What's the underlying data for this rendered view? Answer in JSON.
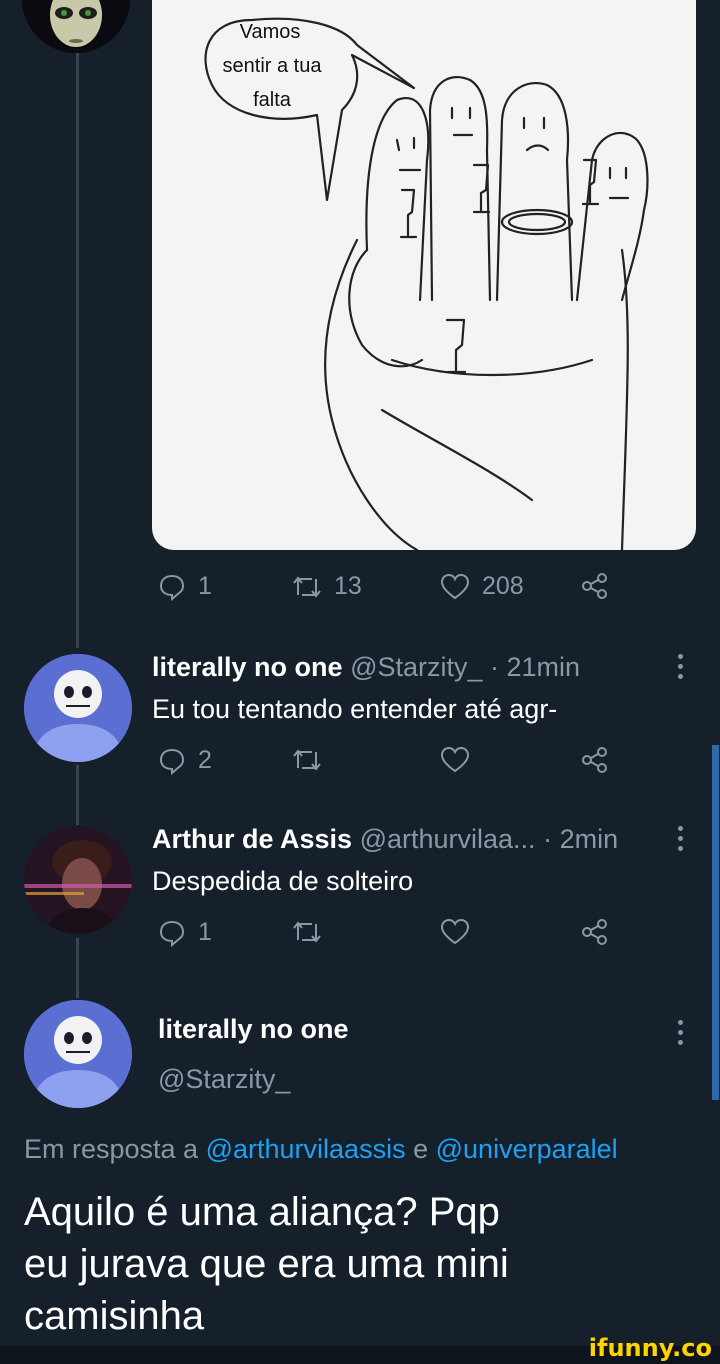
{
  "media": {
    "speech_bubble": [
      "Vamos",
      "sentir a tua",
      "falta"
    ]
  },
  "main_tweet_actions": {
    "replies": "1",
    "retweets": "13",
    "likes": "208"
  },
  "replies": [
    {
      "name": "literally no one",
      "handle": "@Starzity_",
      "time": "· 21min",
      "text": "Eu tou tentando entender até agr-",
      "reply_count": "2"
    },
    {
      "name": "Arthur de Assis",
      "handle": "@arthurvilaa...",
      "time": "· 2min",
      "text": "Despedida de solteiro",
      "reply_count": "1"
    }
  ],
  "focused": {
    "name": "literally no one",
    "handle": "@Starzity_",
    "reply_prefix": "Em resposta a",
    "mention1": "@arthurvilaassis",
    "conj": "e",
    "mention2": "@univerparalel",
    "text_lines": [
      "Aquilo é uma aliança? Pqp",
      "eu jurava que era uma mini",
      "camisinha"
    ]
  },
  "watermark": "ifunny.co",
  "colors": {
    "background": "#15202b",
    "muted": "#8899a6",
    "link": "#1da1f2",
    "brand": "#ffd400"
  }
}
